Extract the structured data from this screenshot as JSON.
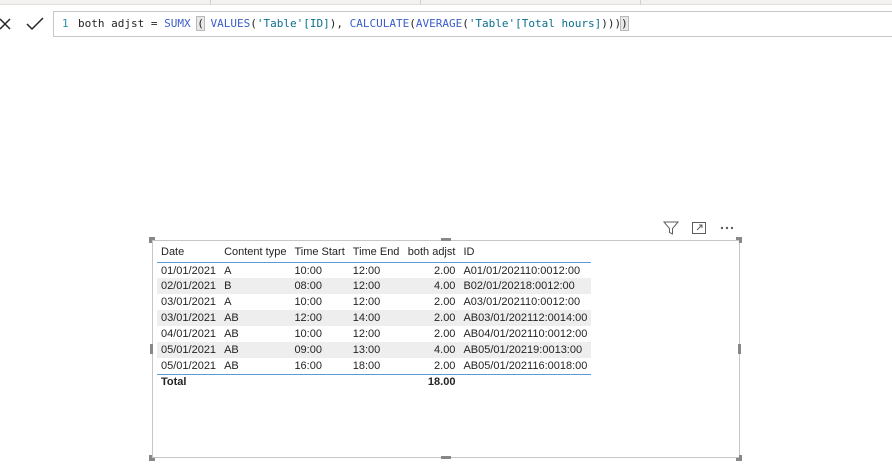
{
  "formula_bar": {
    "line_number": "1",
    "measure_name": "both adjst",
    "tokens": {
      "eq": " = ",
      "sumx": "SUMX",
      "sp1": " ",
      "open_paren": "(",
      "sp2": " ",
      "values_fn": "VALUES",
      "p1": "(",
      "id_ref": "'Table'[ID]",
      "p2": "), ",
      "calculate_fn": "CALCULATE",
      "p3": "(",
      "average_fn": "AVERAGE",
      "p4": "(",
      "hours_ref": "'Table'[Total hours]",
      "p5": ")))",
      "close_paren": ")"
    }
  },
  "visual_header": {
    "icons": [
      "filter-icon",
      "focus-mode-icon",
      "more-options-icon"
    ]
  },
  "table": {
    "columns": [
      "Date",
      "Content type",
      "Time Start",
      "Time End",
      "both adjst",
      "ID"
    ],
    "rows": [
      [
        "01/01/2021",
        "A",
        "10:00",
        "12:00",
        "2.00",
        "A01/01/202110:0012:00"
      ],
      [
        "02/01/2021",
        "B",
        "08:00",
        "12:00",
        "4.00",
        "B02/01/20218:0012:00"
      ],
      [
        "03/01/2021",
        "A",
        "10:00",
        "12:00",
        "2.00",
        "A03/01/202110:0012:00"
      ],
      [
        "03/01/2021",
        "AB",
        "12:00",
        "14:00",
        "2.00",
        "AB03/01/202112:0014:00"
      ],
      [
        "04/01/2021",
        "AB",
        "10:00",
        "12:00",
        "2.00",
        "AB04/01/202110:0012:00"
      ],
      [
        "05/01/2021",
        "AB",
        "09:00",
        "13:00",
        "4.00",
        "AB05/01/20219:0013:00"
      ],
      [
        "05/01/2021",
        "AB",
        "16:00",
        "18:00",
        "2.00",
        "AB05/01/202116:0018:00"
      ]
    ],
    "total_label": "Total",
    "total_value": "18.00"
  },
  "colors": {
    "header_rule": "#5b9bd5",
    "alt_row": "#eeeeee",
    "dax_function": "#3a5ec9",
    "dax_string": "#0b6f8f"
  }
}
